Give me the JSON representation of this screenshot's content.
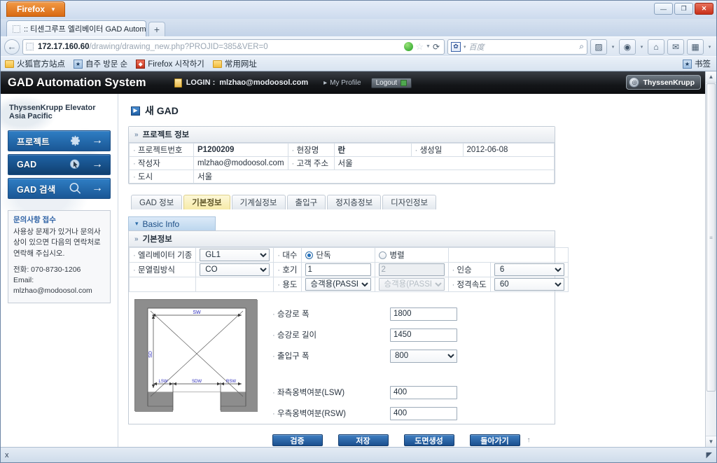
{
  "browser": {
    "app_button": "Firefox",
    "tab_title": ":: 티센그루프 엘리베이터 GAD Automa...",
    "new_tab_label": "+",
    "url_host": "172.17.160.60",
    "url_path": "/drawing/drawing_new.php?PROJID=385&VER=0",
    "search_placeholder": "百度",
    "bookmarks": [
      {
        "label": "火狐官方站点",
        "icon": "folder-icon"
      },
      {
        "label": "自주 방문 순",
        "icon": "bookmark-icon"
      },
      {
        "label": "Firefox 시작하기",
        "icon": "firefox-icon"
      },
      {
        "label": "常用网址",
        "icon": "folder-icon"
      }
    ],
    "bookmarks_right_label": "书签",
    "window_controls": {
      "minimize": "—",
      "maximize": "❐",
      "close": "✕"
    },
    "findbar": {
      "close": "x",
      "resize": "◤"
    }
  },
  "app": {
    "logo_text": "GAD Automation System",
    "login_prefix": "LOGIN :",
    "login_email": "mlzhao@modoosol.com",
    "my_profile": "My Profile",
    "logout": "Logout",
    "brand_badge": "ThyssenKrupp"
  },
  "sidebar": {
    "title": "ThyssenKrupp Elevator Asia Pacific",
    "nav": [
      {
        "label": "프로젝트",
        "icon": "gear-icon",
        "arrow": "→"
      },
      {
        "label": "GAD",
        "icon": "cursor-icon",
        "arrow": "→"
      },
      {
        "label": "GAD 검색",
        "icon": "search-icon",
        "arrow": "→"
      }
    ],
    "info": {
      "heading": "문의사항 접수",
      "text": "사용상 문제가 있거나 문의사상이 있으면 다음의 연락처로 연락해 주십시오.",
      "phone": "전화: 070-8730-1206",
      "email": "Email: mlzhao@modoosol.com"
    }
  },
  "page": {
    "title": "새 GAD",
    "project_panel_title": "프로젝트 정보",
    "project_rows": [
      [
        {
          "label": "프로젝트번호",
          "value": "P1200209",
          "bold": true
        },
        {
          "label": "현장명",
          "value": "란",
          "bold": true
        },
        {
          "label": "생성일",
          "value": "2012-06-08",
          "bold": false
        }
      ],
      [
        {
          "label": "작성자",
          "value": "mlzhao@modoosol.com",
          "bold": false
        },
        {
          "label": "고객 주소",
          "value": "서울",
          "bold": false
        }
      ],
      [
        {
          "label": "도시",
          "value": "서울",
          "bold": false
        }
      ]
    ],
    "tabs": [
      {
        "label": "GAD 정보",
        "active": false
      },
      {
        "label": "기본정보",
        "active": true
      },
      {
        "label": "기계실정보",
        "active": false
      },
      {
        "label": "출입구",
        "active": false
      },
      {
        "label": "정지층정보",
        "active": false
      },
      {
        "label": "디자인정보",
        "active": false
      }
    ],
    "basic_info_tab": "Basic Info",
    "basic_info_panel_title": "기본정보",
    "form": {
      "elevator_model": {
        "label": "엘리베이터 기종",
        "value": "GL1",
        "options": [
          "GL1"
        ]
      },
      "door_type": {
        "label": "문열림방식",
        "value": "CO",
        "options": [
          "CO"
        ]
      },
      "units": {
        "label": "대수",
        "single": {
          "label": "단독",
          "selected": true
        },
        "duplex": {
          "label": "병렬",
          "selected": false
        }
      },
      "car_no": {
        "label": "호기",
        "value1": "1",
        "value2": "2",
        "value2_disabled": true
      },
      "usage": {
        "label": "용도",
        "value1": "승객용(PASSE",
        "value2": "승객용(PASSE",
        "value2_disabled": true
      },
      "persons": {
        "label": "인승",
        "value": "6",
        "options": [
          "6"
        ]
      },
      "speed": {
        "label": "정격속도",
        "value": "60",
        "options": [
          "60"
        ]
      },
      "hoistway_width": {
        "label": "승강로 폭",
        "value": "1800"
      },
      "hoistway_depth": {
        "label": "승강로 길이",
        "value": "1450"
      },
      "entrance_width": {
        "label": "출입구 폭",
        "value": "800",
        "options": [
          "800"
        ]
      },
      "lsw": {
        "label": "좌측옹벽여분(LSW)",
        "value": "400"
      },
      "rsw": {
        "label": "우측옹벽여분(RSW)",
        "value": "400"
      }
    },
    "diagram": {
      "labels": [
        "SW",
        "SD",
        "LSW",
        "SDW",
        "RSW"
      ]
    },
    "buttons": [
      {
        "label": "검증",
        "name": "validate-button"
      },
      {
        "label": "저장",
        "name": "save-button"
      },
      {
        "label": "도면생성",
        "name": "generate-drawing-button"
      },
      {
        "label": "돌아가기",
        "name": "back-button"
      }
    ],
    "trailing_mark": "↑"
  }
}
